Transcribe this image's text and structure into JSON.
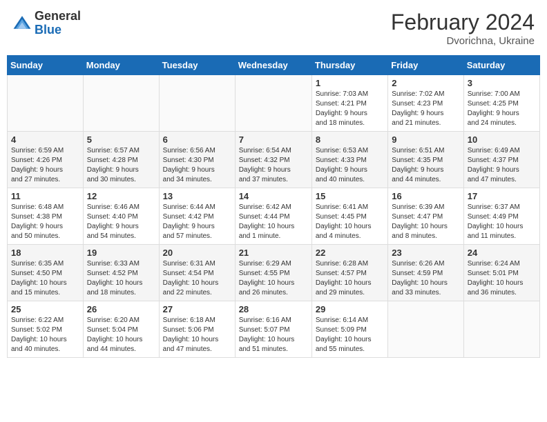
{
  "header": {
    "logo_general": "General",
    "logo_blue": "Blue",
    "month_year": "February 2024",
    "location": "Dvorichna, Ukraine"
  },
  "days_of_week": [
    "Sunday",
    "Monday",
    "Tuesday",
    "Wednesday",
    "Thursday",
    "Friday",
    "Saturday"
  ],
  "weeks": [
    [
      {
        "day": "",
        "info": ""
      },
      {
        "day": "",
        "info": ""
      },
      {
        "day": "",
        "info": ""
      },
      {
        "day": "",
        "info": ""
      },
      {
        "day": "1",
        "info": "Sunrise: 7:03 AM\nSunset: 4:21 PM\nDaylight: 9 hours\nand 18 minutes."
      },
      {
        "day": "2",
        "info": "Sunrise: 7:02 AM\nSunset: 4:23 PM\nDaylight: 9 hours\nand 21 minutes."
      },
      {
        "day": "3",
        "info": "Sunrise: 7:00 AM\nSunset: 4:25 PM\nDaylight: 9 hours\nand 24 minutes."
      }
    ],
    [
      {
        "day": "4",
        "info": "Sunrise: 6:59 AM\nSunset: 4:26 PM\nDaylight: 9 hours\nand 27 minutes."
      },
      {
        "day": "5",
        "info": "Sunrise: 6:57 AM\nSunset: 4:28 PM\nDaylight: 9 hours\nand 30 minutes."
      },
      {
        "day": "6",
        "info": "Sunrise: 6:56 AM\nSunset: 4:30 PM\nDaylight: 9 hours\nand 34 minutes."
      },
      {
        "day": "7",
        "info": "Sunrise: 6:54 AM\nSunset: 4:32 PM\nDaylight: 9 hours\nand 37 minutes."
      },
      {
        "day": "8",
        "info": "Sunrise: 6:53 AM\nSunset: 4:33 PM\nDaylight: 9 hours\nand 40 minutes."
      },
      {
        "day": "9",
        "info": "Sunrise: 6:51 AM\nSunset: 4:35 PM\nDaylight: 9 hours\nand 44 minutes."
      },
      {
        "day": "10",
        "info": "Sunrise: 6:49 AM\nSunset: 4:37 PM\nDaylight: 9 hours\nand 47 minutes."
      }
    ],
    [
      {
        "day": "11",
        "info": "Sunrise: 6:48 AM\nSunset: 4:38 PM\nDaylight: 9 hours\nand 50 minutes."
      },
      {
        "day": "12",
        "info": "Sunrise: 6:46 AM\nSunset: 4:40 PM\nDaylight: 9 hours\nand 54 minutes."
      },
      {
        "day": "13",
        "info": "Sunrise: 6:44 AM\nSunset: 4:42 PM\nDaylight: 9 hours\nand 57 minutes."
      },
      {
        "day": "14",
        "info": "Sunrise: 6:42 AM\nSunset: 4:44 PM\nDaylight: 10 hours\nand 1 minute."
      },
      {
        "day": "15",
        "info": "Sunrise: 6:41 AM\nSunset: 4:45 PM\nDaylight: 10 hours\nand 4 minutes."
      },
      {
        "day": "16",
        "info": "Sunrise: 6:39 AM\nSunset: 4:47 PM\nDaylight: 10 hours\nand 8 minutes."
      },
      {
        "day": "17",
        "info": "Sunrise: 6:37 AM\nSunset: 4:49 PM\nDaylight: 10 hours\nand 11 minutes."
      }
    ],
    [
      {
        "day": "18",
        "info": "Sunrise: 6:35 AM\nSunset: 4:50 PM\nDaylight: 10 hours\nand 15 minutes."
      },
      {
        "day": "19",
        "info": "Sunrise: 6:33 AM\nSunset: 4:52 PM\nDaylight: 10 hours\nand 18 minutes."
      },
      {
        "day": "20",
        "info": "Sunrise: 6:31 AM\nSunset: 4:54 PM\nDaylight: 10 hours\nand 22 minutes."
      },
      {
        "day": "21",
        "info": "Sunrise: 6:29 AM\nSunset: 4:55 PM\nDaylight: 10 hours\nand 26 minutes."
      },
      {
        "day": "22",
        "info": "Sunrise: 6:28 AM\nSunset: 4:57 PM\nDaylight: 10 hours\nand 29 minutes."
      },
      {
        "day": "23",
        "info": "Sunrise: 6:26 AM\nSunset: 4:59 PM\nDaylight: 10 hours\nand 33 minutes."
      },
      {
        "day": "24",
        "info": "Sunrise: 6:24 AM\nSunset: 5:01 PM\nDaylight: 10 hours\nand 36 minutes."
      }
    ],
    [
      {
        "day": "25",
        "info": "Sunrise: 6:22 AM\nSunset: 5:02 PM\nDaylight: 10 hours\nand 40 minutes."
      },
      {
        "day": "26",
        "info": "Sunrise: 6:20 AM\nSunset: 5:04 PM\nDaylight: 10 hours\nand 44 minutes."
      },
      {
        "day": "27",
        "info": "Sunrise: 6:18 AM\nSunset: 5:06 PM\nDaylight: 10 hours\nand 47 minutes."
      },
      {
        "day": "28",
        "info": "Sunrise: 6:16 AM\nSunset: 5:07 PM\nDaylight: 10 hours\nand 51 minutes."
      },
      {
        "day": "29",
        "info": "Sunrise: 6:14 AM\nSunset: 5:09 PM\nDaylight: 10 hours\nand 55 minutes."
      },
      {
        "day": "",
        "info": ""
      },
      {
        "day": "",
        "info": ""
      }
    ]
  ]
}
